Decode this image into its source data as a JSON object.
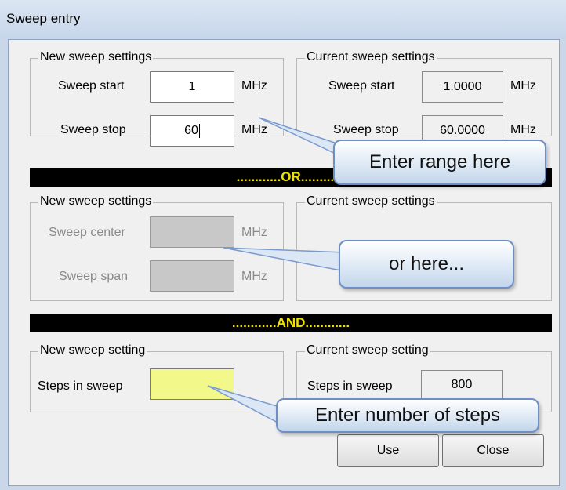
{
  "window": {
    "title": "Sweep entry"
  },
  "range_section": {
    "new_legend": "New sweep settings",
    "current_legend": "Current sweep settings",
    "start_label": "Sweep start",
    "stop_label": "Sweep stop",
    "unit": "MHz",
    "new_start_value": "1",
    "new_stop_value": "60",
    "current_start_value": "1.0000",
    "current_stop_value": "60.0000"
  },
  "or_band": "............OR............",
  "center_section": {
    "new_legend": "New sweep settings",
    "current_legend": "Current sweep settings",
    "center_label": "Sweep center",
    "span_label": "Sweep span",
    "unit": "MHz"
  },
  "and_band": "............AND............",
  "steps_section": {
    "new_legend": "New sweep setting",
    "current_legend": "Current sweep setting",
    "steps_label": "Steps in sweep",
    "new_steps_value": "",
    "current_steps_value": "800"
  },
  "buttons": {
    "use_label": "Use",
    "close_label": "Close"
  },
  "callouts": {
    "range": "Enter range here",
    "center": "or here...",
    "steps": "Enter number of steps"
  },
  "colors": {
    "band_bg": "#000000",
    "band_text": "#f0e000",
    "steps_input_bg": "#f3f88a"
  }
}
